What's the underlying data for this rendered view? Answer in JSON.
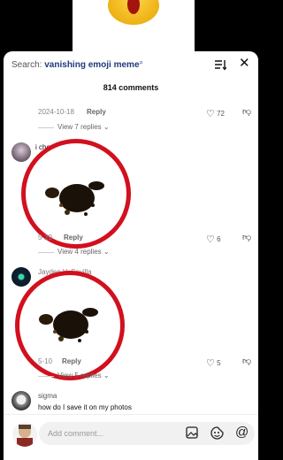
{
  "search": {
    "prefix": "Search:",
    "query": "vanishing emoji meme"
  },
  "comment_count": "814 comments",
  "comments": [
    {
      "date": "2024-10-18",
      "reply": "Reply",
      "likes": "72",
      "view_replies": "View 7 replies"
    },
    {
      "text": "i chew pencils.",
      "date": "5-29",
      "reply": "Reply",
      "likes": "6",
      "view_replies": "View 4 replies"
    },
    {
      "username": "Jayden V. Sevilla",
      "date": "5-10",
      "reply": "Reply",
      "likes": "5",
      "view_replies": "View 5 replies"
    },
    {
      "username": "sigma",
      "text": "how do I save it on my photos"
    }
  ],
  "composer": {
    "placeholder": "Add comment..."
  },
  "icons": [
    "sort-icon",
    "close-icon",
    "heart-icon",
    "dislike-icon",
    "chevron-down-icon",
    "image-icon",
    "sticker-icon",
    "mention-icon"
  ],
  "colors": {
    "accent": "#d2101e",
    "query": "#1d3b7c"
  }
}
